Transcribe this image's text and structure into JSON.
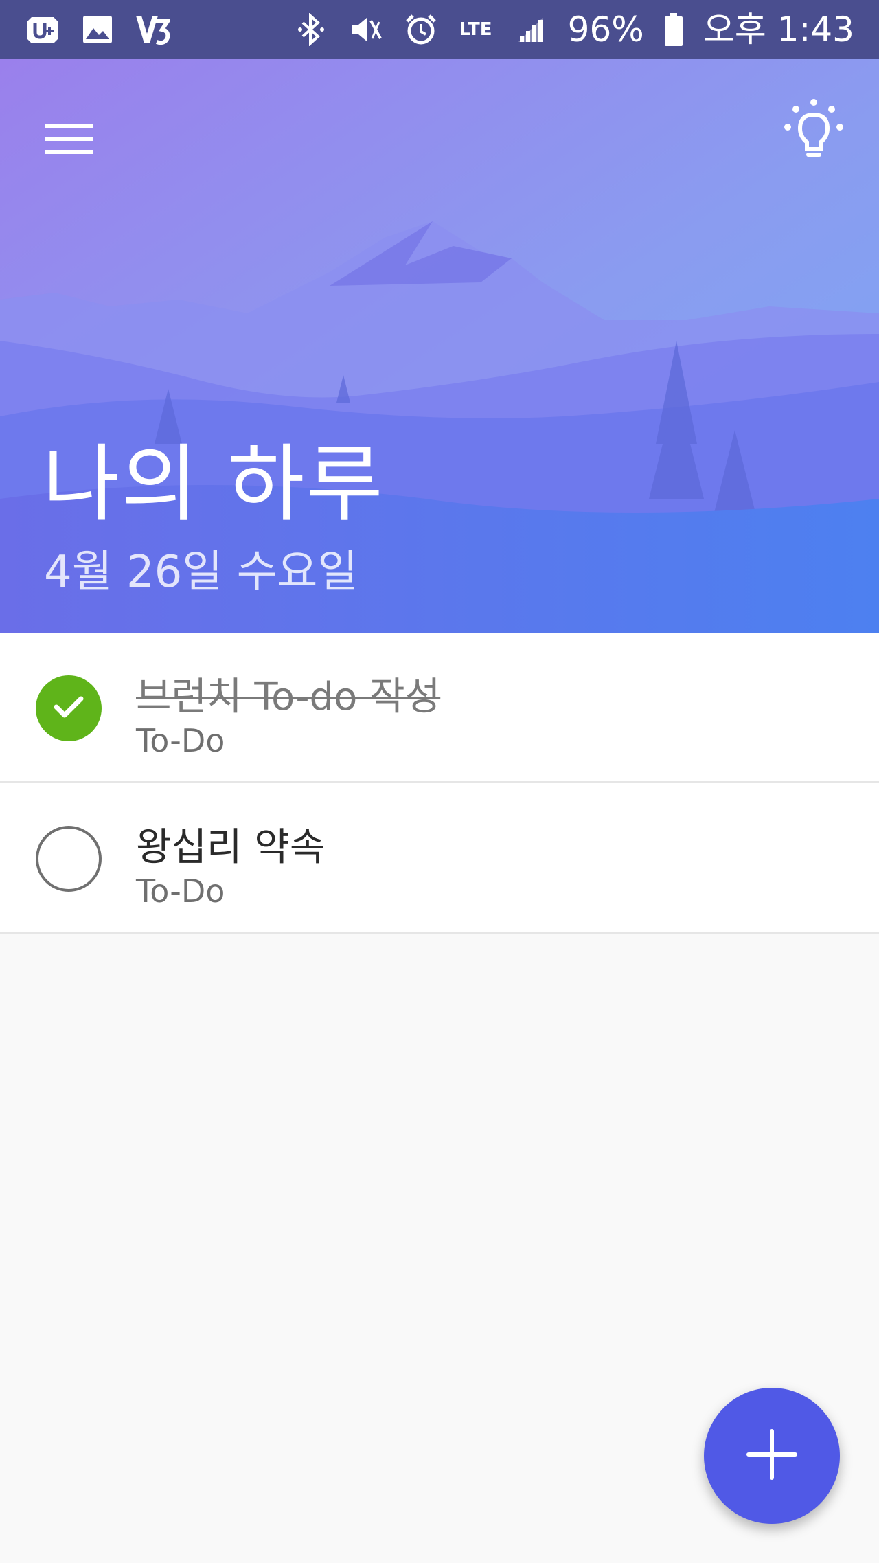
{
  "status_bar": {
    "left_icons": [
      "u-plus-icon",
      "gallery-icon",
      "v3-icon"
    ],
    "right_icons": [
      "bluetooth-icon",
      "mute-icon",
      "alarm-icon",
      "lte-icon",
      "signal-icon",
      "battery-icon"
    ],
    "lte_label": "LTE",
    "battery": "96%",
    "time": "오후 1:43"
  },
  "header": {
    "menu_icon": "hamburger-menu-icon",
    "suggestions_icon": "lightbulb-icon",
    "title": "나의 하루",
    "date": "4월 26일 수요일"
  },
  "tasks": [
    {
      "title": "브런치 To-do 작성",
      "list": "To-Do",
      "completed": true
    },
    {
      "title": "왕십리 약속",
      "list": "To-Do",
      "completed": false
    }
  ],
  "fab": {
    "icon": "plus-icon"
  },
  "colors": {
    "status_bar": "#4a4e8f",
    "check_done": "#5fb41a",
    "fab": "#5059e6",
    "hero_top": "#9a86ee",
    "hero_bottom": "#4b7ef0"
  }
}
